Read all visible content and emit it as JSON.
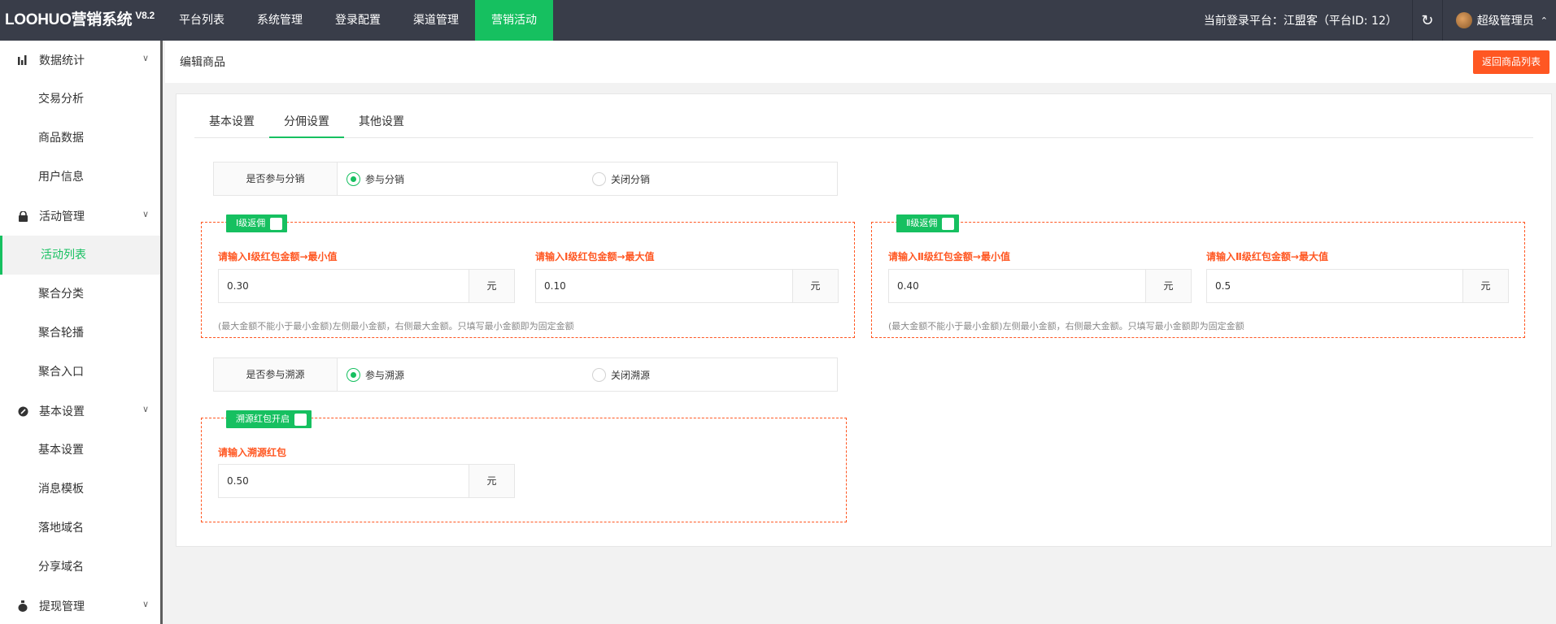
{
  "header": {
    "logo": "LOOHUO营销系统",
    "version": "V8.2",
    "nav": [
      "平台列表",
      "系统管理",
      "登录配置",
      "渠道管理",
      "营销活动"
    ],
    "active_nav": "营销活动",
    "platform_text": "当前登录平台：江盟客（平台ID: 12）",
    "refresh_icon": "refresh-icon",
    "user_name": "超级管理员"
  },
  "sidebar": {
    "groups": [
      {
        "label": "数据统计",
        "icon": "bar-chart-icon",
        "items": [
          "交易分析",
          "商品数据",
          "用户信息"
        ]
      },
      {
        "label": "活动管理",
        "icon": "bag-icon",
        "items": [
          "活动列表",
          "聚合分类",
          "聚合轮播",
          "聚合入口"
        ]
      },
      {
        "label": "基本设置",
        "icon": "settings-icon",
        "items": [
          "基本设置",
          "消息模板",
          "落地域名",
          "分享域名"
        ]
      },
      {
        "label": "提现管理",
        "icon": "money-bag-icon",
        "items": []
      }
    ],
    "active_item": "活动列表"
  },
  "page": {
    "title": "编辑商品",
    "back_button": "返回商品列表"
  },
  "tabs": [
    "基本设置",
    "分佣设置",
    "其他设置"
  ],
  "active_tab": "分佣设置",
  "distribution": {
    "label": "是否参与分销",
    "option_on": "参与分销",
    "option_off": "关闭分销",
    "selected": "参与分销"
  },
  "level1": {
    "legend": "Ⅰ级返佣",
    "checked": false,
    "min_label": "请输入Ⅰ级红包金额→最小值",
    "min_value": "0.30",
    "max_label": "请输入Ⅰ级红包金额→最大值",
    "max_value": "0.10",
    "unit": "元",
    "hint": "(最大金额不能小于最小金额)左侧最小金额，右侧最大金额。只填写最小金额即为固定金额"
  },
  "level2": {
    "legend": "Ⅱ级返佣",
    "checked": false,
    "min_label": "请输入Ⅱ级红包金额→最小值",
    "min_value": "0.40",
    "max_label": "请输入Ⅱ级红包金额→最大值",
    "max_value": "0.5",
    "unit": "元",
    "hint": "(最大金额不能小于最小金额)左侧最小金额，右侧最大金额。只填写最小金额即为固定金额"
  },
  "traceback": {
    "label": "是否参与溯源",
    "option_on": "参与溯源",
    "option_off": "关闭溯源",
    "selected": "参与溯源"
  },
  "trace_redpacket": {
    "legend": "溯源红包开启",
    "checked": false,
    "field_label": "请输入溯源红包",
    "value": "0.50",
    "unit": "元"
  },
  "colors": {
    "accent": "#16c060",
    "danger": "#ff5722",
    "header_bg": "#393d49"
  }
}
